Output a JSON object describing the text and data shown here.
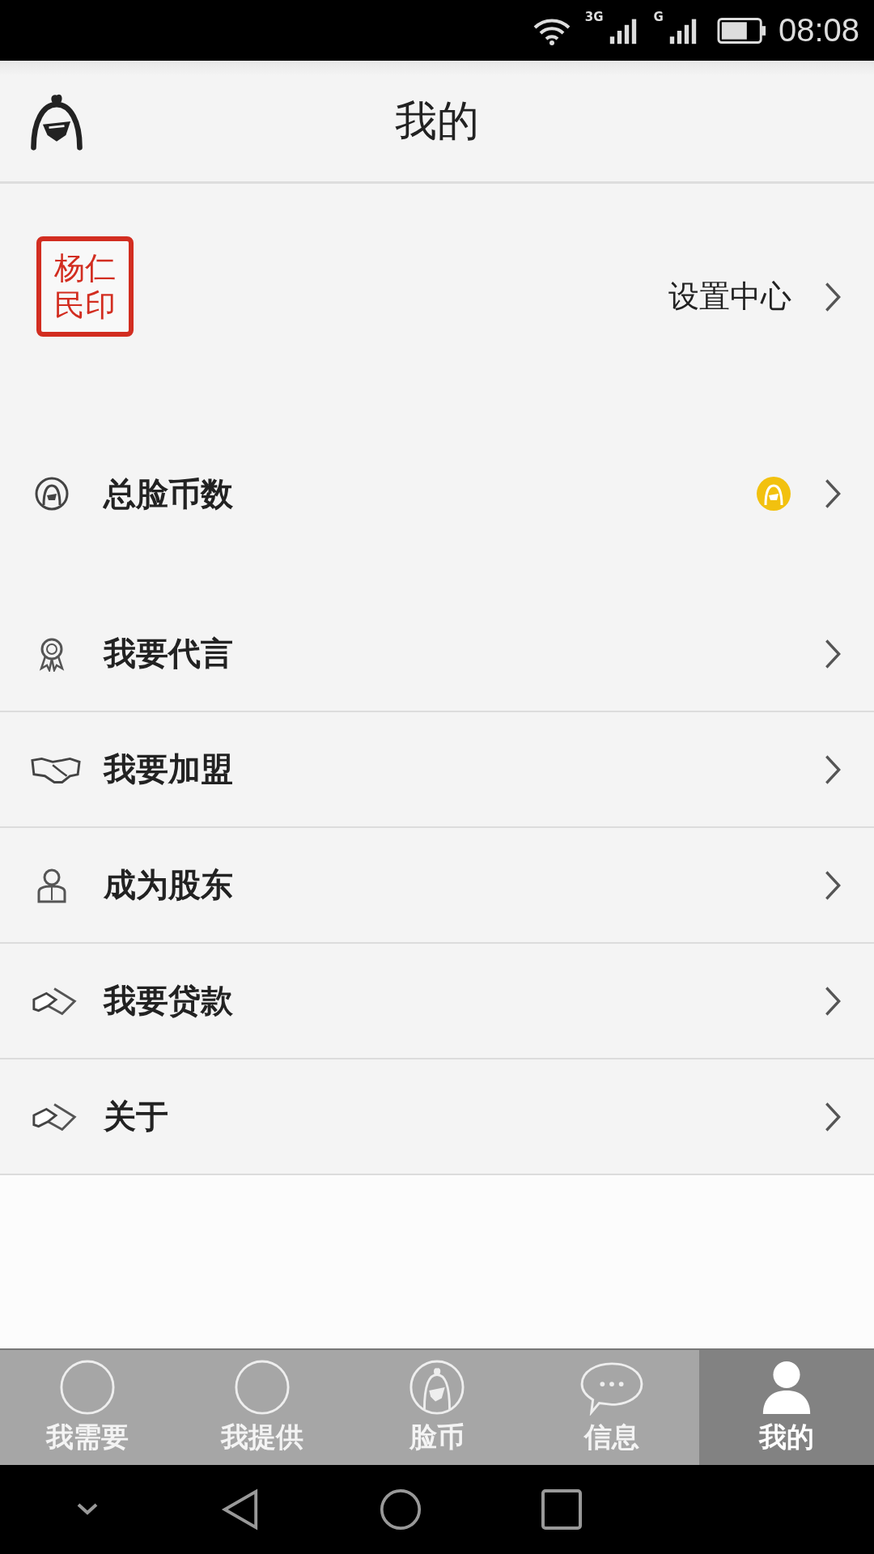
{
  "status_bar": {
    "network_1": "3G",
    "network_2": "G",
    "time": "08:08"
  },
  "header": {
    "title": "我的"
  },
  "profile": {
    "seal_lines": [
      "杨仁",
      "民印"
    ],
    "settings_label": "设置中心"
  },
  "coin_row": {
    "label": "总脸币数"
  },
  "menu": [
    {
      "kind": "award",
      "label": "我要代言"
    },
    {
      "kind": "handshake",
      "label": "我要加盟"
    },
    {
      "kind": "person",
      "label": "成为股东"
    },
    {
      "kind": "hand",
      "label": "我要贷款"
    },
    {
      "kind": "hand",
      "label": "关于"
    }
  ],
  "tabs": [
    {
      "kind": "circle",
      "label": "我需要",
      "selected": false
    },
    {
      "kind": "circle",
      "label": "我提供",
      "selected": false
    },
    {
      "kind": "mascot",
      "label": "脸币",
      "selected": false
    },
    {
      "kind": "chat",
      "label": "信息",
      "selected": false
    },
    {
      "kind": "person",
      "label": "我的",
      "selected": true
    }
  ]
}
